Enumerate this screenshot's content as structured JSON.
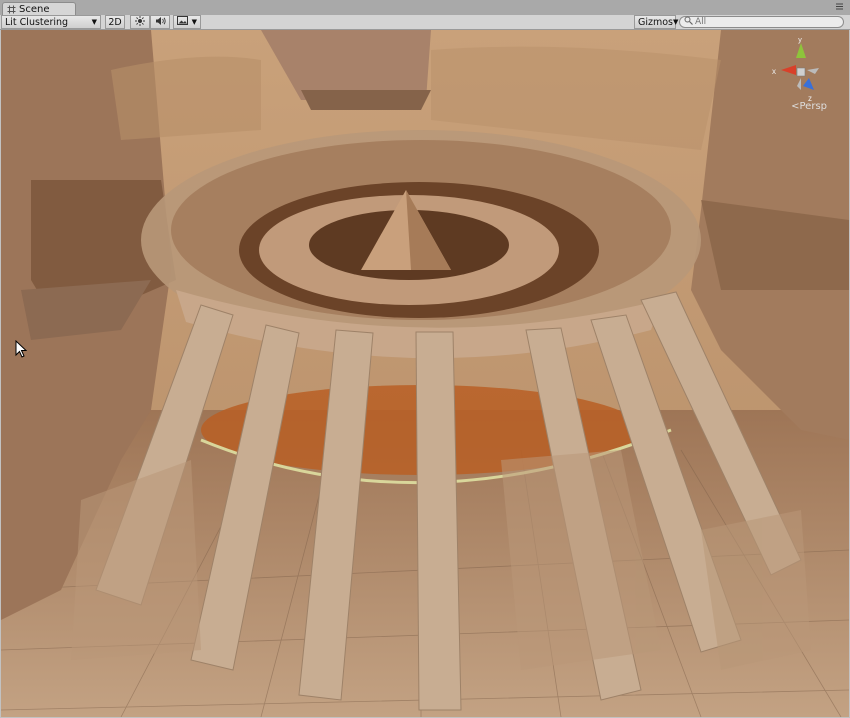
{
  "tab": {
    "title": "Scene",
    "icon": "hash-grid-icon"
  },
  "window_menu_icon": "context-menu-icon",
  "toolbar": {
    "draw_mode": "Lit Clustering",
    "mode_2d": "2D",
    "lighting_icon": "sun-icon",
    "audio_icon": "speaker-icon",
    "effects_icon": "image-icon",
    "gizmos_label": "Gizmos",
    "search_placeholder": "All"
  },
  "orientation_gizmo": {
    "x_label": "x",
    "y_label": "y",
    "z_label": "z",
    "projection_label": "Persp",
    "colors": {
      "x": "#d8402a",
      "y": "#8ec43b",
      "z": "#3a70d8"
    }
  },
  "scene": {
    "description_colors": {
      "ground": "#bf9a78",
      "sky": "#d8b88e",
      "wood_dark": "#7a5536",
      "wood_light": "#c7a584",
      "orange": "#c86e2d"
    }
  }
}
